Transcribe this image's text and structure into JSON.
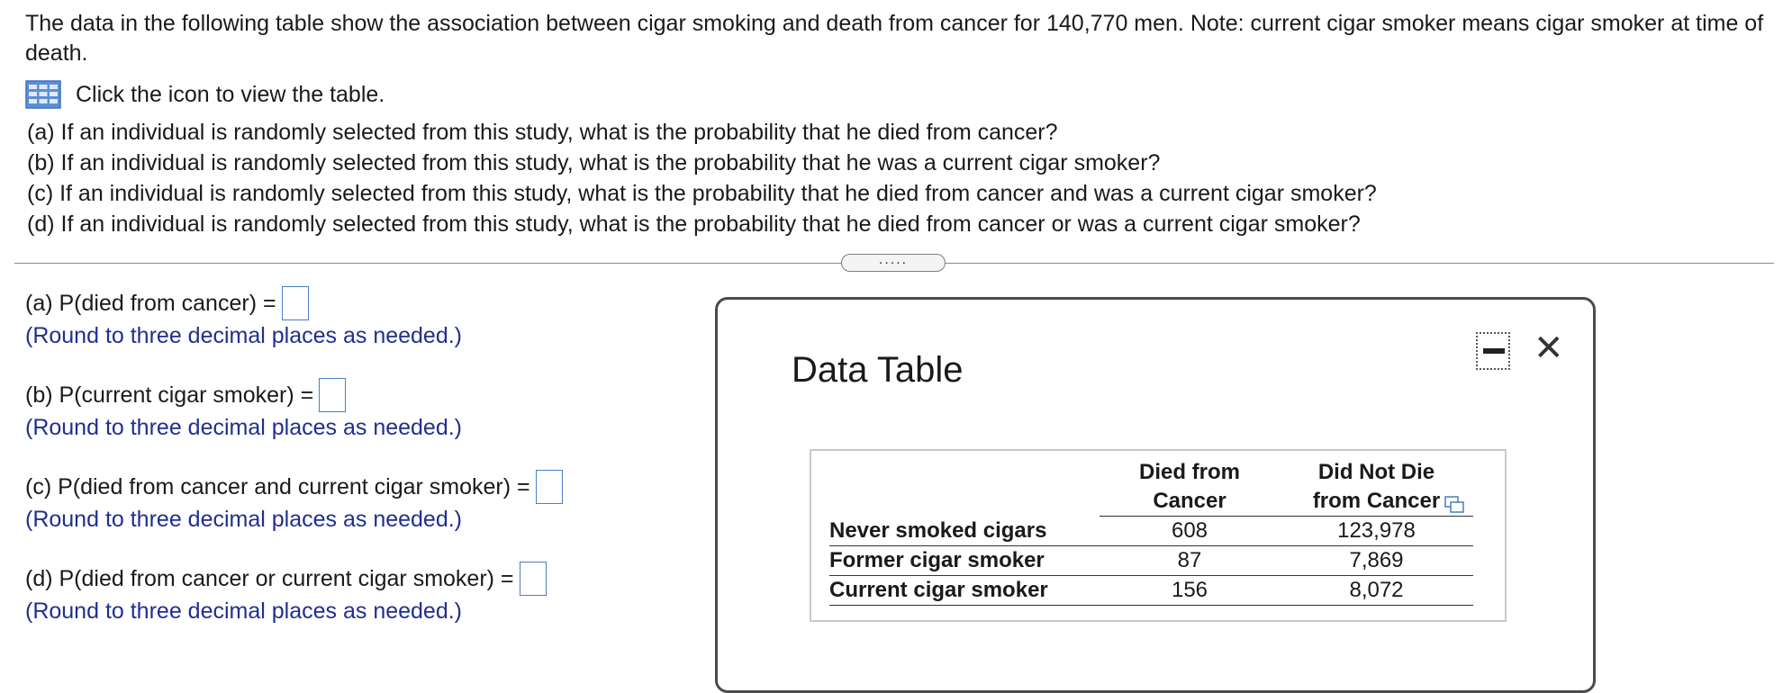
{
  "problem": {
    "intro": "The data in the following table show the association between cigar smoking and death from cancer for 140,770 men. Note: current cigar smoker means cigar smoker at time of death.",
    "table_link_label": "Click the icon to view the table.",
    "table_icon": "table-grid-icon",
    "questions": [
      "(a) If an individual is randomly selected from this study, what is the probability that he died from cancer?",
      "(b) If an individual is randomly selected from this study, what is the probability that he was a current cigar smoker?",
      "(c) If an individual is randomly selected from this study, what is the probability that he died from cancer and was a current cigar smoker?",
      "(d) If an individual is randomly selected from this study, what is the probability that he died from cancer or was a current cigar smoker?"
    ]
  },
  "divider": {
    "handle_label": "....."
  },
  "answers": [
    {
      "prompt": "(a) P(died from cancer) =",
      "value": "",
      "hint": "(Round to three decimal places as needed.)"
    },
    {
      "prompt": "(b) P(current cigar smoker) =",
      "value": "",
      "hint": "(Round to three decimal places as needed.)"
    },
    {
      "prompt": "(c) P(died from cancer and current cigar smoker) =",
      "value": "",
      "hint": "(Round to three decimal places as needed.)"
    },
    {
      "prompt": "(d) P(died from cancer or current cigar smoker) =",
      "value": "",
      "hint": "(Round to three decimal places as needed.)"
    }
  ],
  "dialog": {
    "title": "Data Table",
    "minimize_icon": "minimize-icon",
    "close_icon": "close-icon",
    "close_glyph": "✕",
    "copy_icon": "copy-icon",
    "table": {
      "headers": [
        "",
        "Died from Cancer",
        "Did Not Die from Cancer"
      ],
      "rows": [
        {
          "label": "Never smoked cigars",
          "died": "608",
          "not_died": "123,978"
        },
        {
          "label": "Former cigar smoker",
          "died": "87",
          "not_died": "7,869"
        },
        {
          "label": "Current cigar smoker",
          "died": "156",
          "not_died": "8,072"
        }
      ]
    }
  },
  "colors": {
    "hint_text": "#1f2f8f",
    "input_border": "#4a7fc0",
    "icon_blue": "#5b8fd6"
  }
}
